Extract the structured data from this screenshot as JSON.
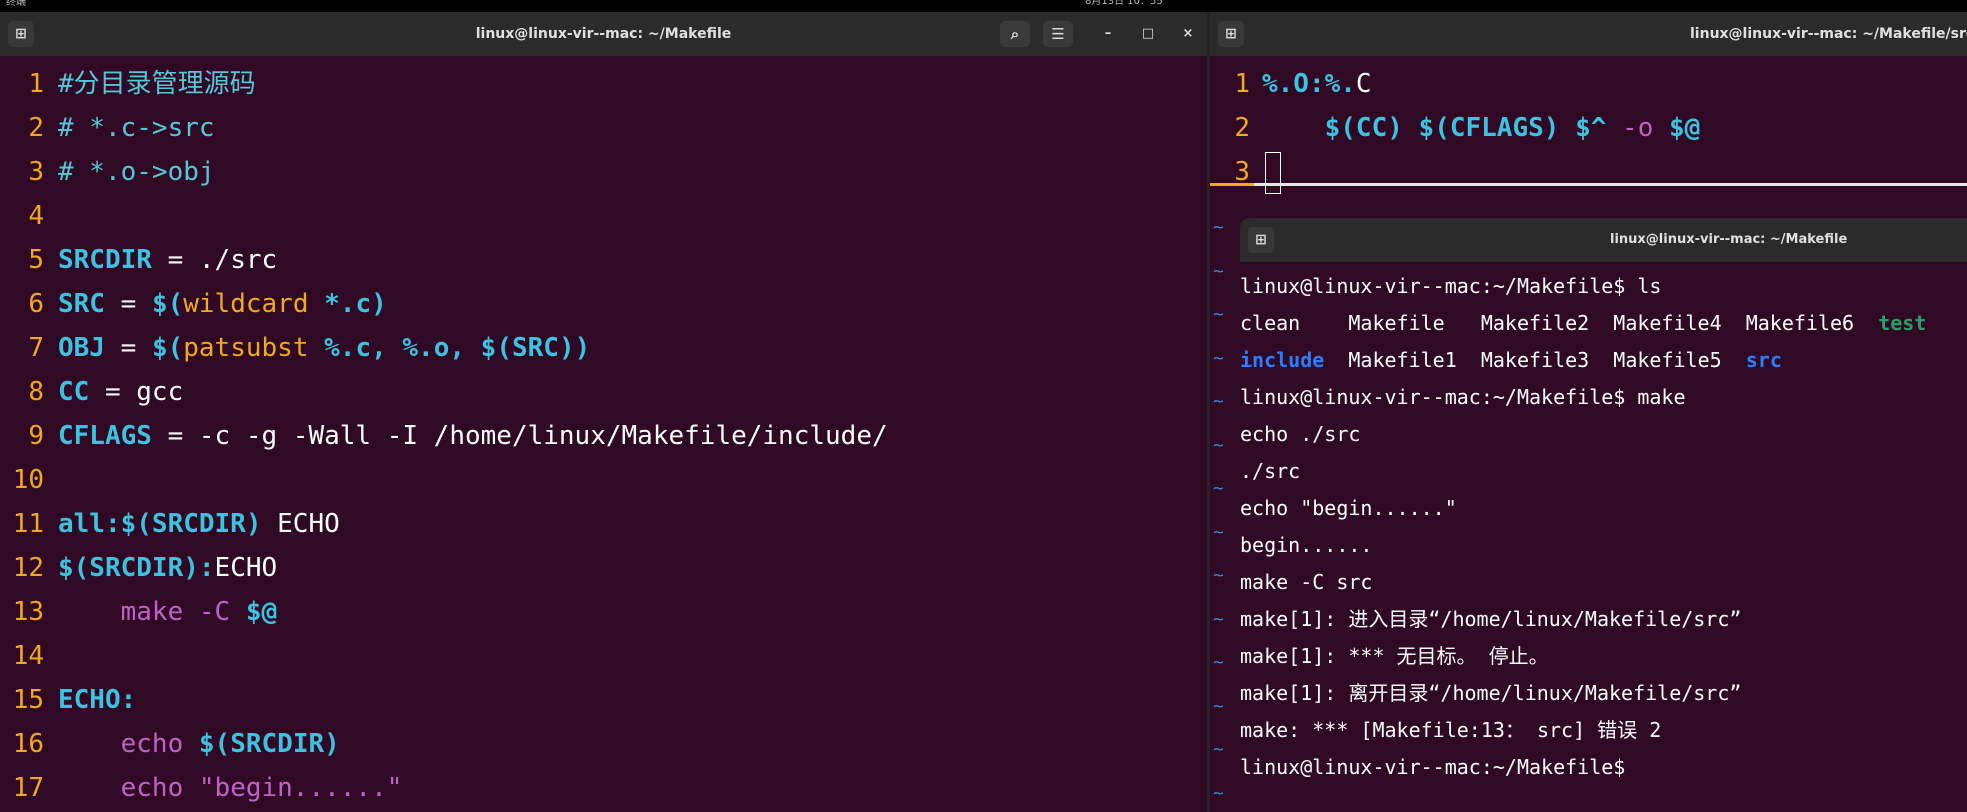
{
  "topbar": {
    "activities": "终端",
    "clock": "8月13日 10：55"
  },
  "left_window": {
    "title": "linux@linux-vir--mac: ~/Makefile",
    "buttons": {
      "new_tab": "⊞",
      "search": "⌕",
      "menu": "☰",
      "minimize": "–",
      "maximize": "□",
      "close": "×"
    },
    "lines": [
      {
        "n": "1",
        "segments": [
          {
            "cls": "comment",
            "t": "#分目录管理源码"
          }
        ]
      },
      {
        "n": "2",
        "segments": [
          {
            "cls": "comment",
            "t": "# *.c->src"
          }
        ]
      },
      {
        "n": "3",
        "segments": [
          {
            "cls": "comment",
            "t": "# *.o->obj"
          }
        ]
      },
      {
        "n": "4",
        "segments": []
      },
      {
        "n": "5",
        "segments": [
          {
            "cls": "var",
            "t": "SRCDIR"
          },
          {
            "cls": "txt",
            "t": " = ./src"
          }
        ]
      },
      {
        "n": "6",
        "segments": [
          {
            "cls": "var",
            "t": "SRC"
          },
          {
            "cls": "txt",
            "t": " = "
          },
          {
            "cls": "var",
            "t": "$("
          },
          {
            "cls": "func",
            "t": "wildcard"
          },
          {
            "cls": "var",
            "t": " *.c)"
          }
        ]
      },
      {
        "n": "7",
        "segments": [
          {
            "cls": "var",
            "t": "OBJ"
          },
          {
            "cls": "txt",
            "t": " = "
          },
          {
            "cls": "var",
            "t": "$("
          },
          {
            "cls": "func",
            "t": "patsubst"
          },
          {
            "cls": "var",
            "t": " %.c, %.o, $(SRC))"
          }
        ]
      },
      {
        "n": "8",
        "segments": [
          {
            "cls": "var",
            "t": "CC"
          },
          {
            "cls": "txt",
            "t": " = gcc"
          }
        ]
      },
      {
        "n": "9",
        "segments": [
          {
            "cls": "var",
            "t": "CFLAGS"
          },
          {
            "cls": "txt",
            "t": " = -c -g -Wall -I /home/linux/Makefile/include/"
          }
        ]
      },
      {
        "n": "10",
        "segments": []
      },
      {
        "n": "11",
        "segments": [
          {
            "cls": "var",
            "t": "all:$(SRCDIR)"
          },
          {
            "cls": "txt",
            "t": " ECHO"
          }
        ]
      },
      {
        "n": "12",
        "segments": [
          {
            "cls": "var",
            "t": "$(SRCDIR):"
          },
          {
            "cls": "txt",
            "t": "ECHO"
          }
        ]
      },
      {
        "n": "13",
        "segments": [
          {
            "cls": "txt",
            "t": "    "
          },
          {
            "cls": "cmd",
            "t": "make -C "
          },
          {
            "cls": "var",
            "t": "$@"
          }
        ]
      },
      {
        "n": "14",
        "segments": []
      },
      {
        "n": "15",
        "segments": [
          {
            "cls": "var",
            "t": "ECHO:"
          }
        ]
      },
      {
        "n": "16",
        "segments": [
          {
            "cls": "txt",
            "t": "    "
          },
          {
            "cls": "cmd",
            "t": "echo "
          },
          {
            "cls": "var",
            "t": "$(SRCDIR)"
          }
        ]
      },
      {
        "n": "17",
        "segments": [
          {
            "cls": "txt",
            "t": "    "
          },
          {
            "cls": "cmd",
            "t": "echo \"begin......\""
          }
        ]
      }
    ]
  },
  "right_window": {
    "title": "linux@linux-vir--mac: ~/Makefile/src",
    "new_tab": "⊞",
    "lines": [
      {
        "n": "1",
        "segments": [
          {
            "cls": "var",
            "t": "%.O:%."
          },
          {
            "cls": "txt",
            "t": "C"
          }
        ]
      },
      {
        "n": "2",
        "segments": [
          {
            "cls": "txt",
            "t": "    "
          },
          {
            "cls": "var",
            "t": "$(CC) $(CFLAGS) $^ "
          },
          {
            "cls": "cmd",
            "t": "-o "
          },
          {
            "cls": "var",
            "t": "$@"
          }
        ]
      },
      {
        "n": "3",
        "segments": [],
        "cursor": true
      }
    ],
    "tilde": "~"
  },
  "terminal": {
    "title": "linux@linux-vir--mac: ~/Makefile",
    "new_tab": "⊞",
    "lines": [
      [
        {
          "cls": "pfx",
          "t": "linux@linux-vir--mac:~/Makefile$ ls"
        }
      ],
      [
        {
          "cls": "pfx",
          "t": "clean    Makefile   Makefile2  Makefile4  Makefile6  "
        },
        {
          "cls": "exe",
          "t": "test"
        }
      ],
      [
        {
          "cls": "dir",
          "t": "include"
        },
        {
          "cls": "pfx",
          "t": "  Makefile1  Makefile3  Makefile5  "
        },
        {
          "cls": "dir",
          "t": "src"
        }
      ],
      [
        {
          "cls": "pfx",
          "t": "linux@linux-vir--mac:~/Makefile$ make"
        }
      ],
      [
        {
          "cls": "pfx",
          "t": "echo ./src"
        }
      ],
      [
        {
          "cls": "pfx",
          "t": "./src"
        }
      ],
      [
        {
          "cls": "pfx",
          "t": "echo \"begin......\""
        }
      ],
      [
        {
          "cls": "pfx",
          "t": "begin......"
        }
      ],
      [
        {
          "cls": "pfx",
          "t": "make -C src"
        }
      ],
      [
        {
          "cls": "pfx",
          "t": "make[1]: 进入目录“/home/linux/Makefile/src”"
        }
      ],
      [
        {
          "cls": "pfx",
          "t": "make[1]: *** 无目标。 停止。"
        }
      ],
      [
        {
          "cls": "pfx",
          "t": "make[1]: 离开目录“/home/linux/Makefile/src”"
        }
      ],
      [
        {
          "cls": "pfx",
          "t": "make: *** [Makefile:13： src] 错误 2"
        }
      ],
      [
        {
          "cls": "pfx",
          "t": "linux@linux-vir--mac:~/Makefile$ "
        }
      ]
    ]
  }
}
